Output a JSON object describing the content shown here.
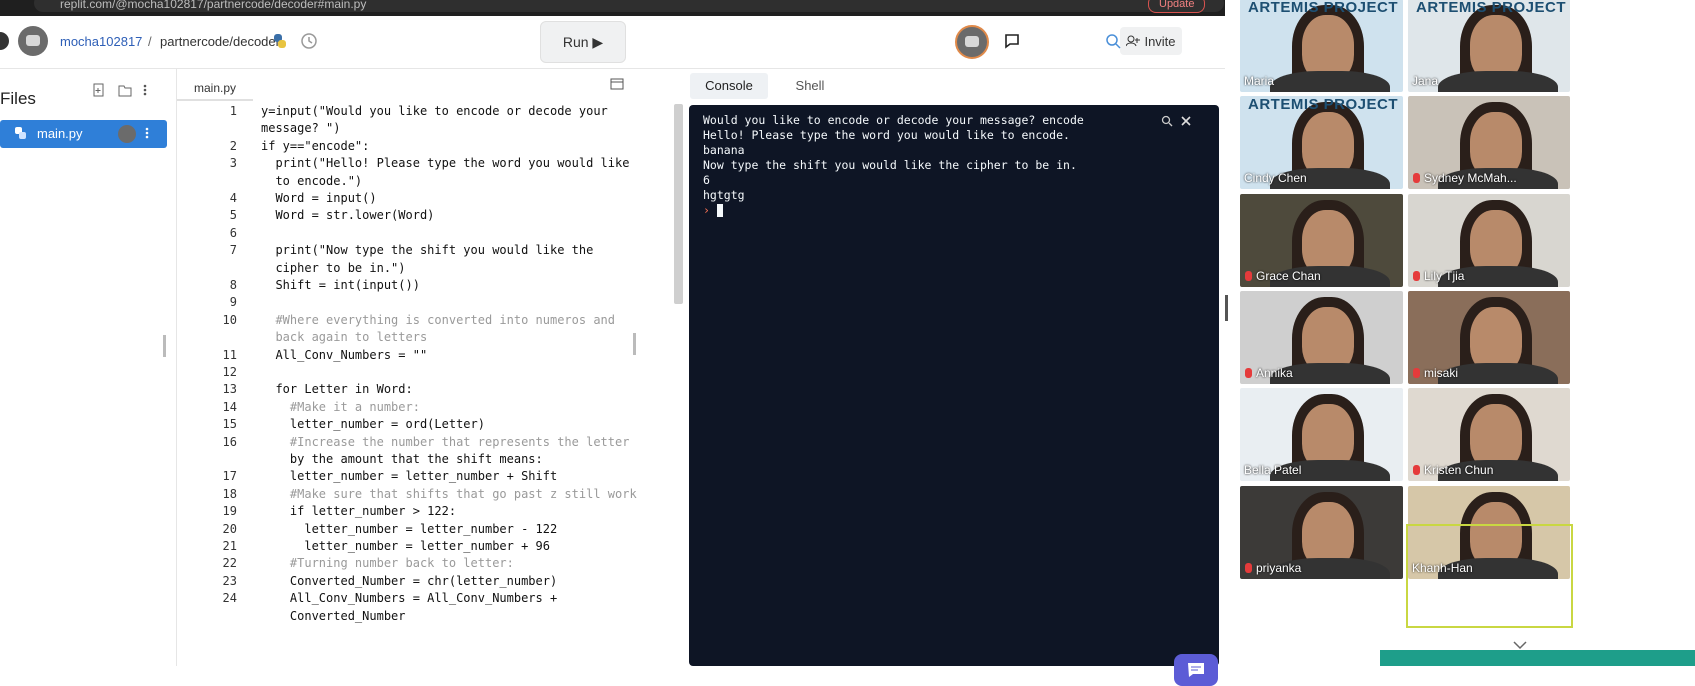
{
  "browser": {
    "url": "replit.com/@mocha102817/partnercode/decoder#main.py",
    "update_label": "Update"
  },
  "header": {
    "username": "mocha102817",
    "separator": "/",
    "project": "partnercode/decoder",
    "run_label": "Run ▶",
    "invite_label": "Invite"
  },
  "sidebar": {
    "title": "Files",
    "files": [
      {
        "name": "main.py"
      }
    ]
  },
  "editor": {
    "tab": "main.py",
    "lines": [
      {
        "n": "1",
        "text": "y=input(\"Would you like to encode or decode your"
      },
      {
        "n": "",
        "text": "message? \")"
      },
      {
        "n": "2",
        "text": "if y==\"encode\":"
      },
      {
        "n": "3",
        "text": "  print(\"Hello! Please type the word you would like"
      },
      {
        "n": "",
        "text": "  to encode.\")"
      },
      {
        "n": "4",
        "text": "  Word = input()"
      },
      {
        "n": "5",
        "text": "  Word = str.lower(Word)"
      },
      {
        "n": "6",
        "text": ""
      },
      {
        "n": "7",
        "text": "  print(\"Now type the shift you would like the"
      },
      {
        "n": "",
        "text": "  cipher to be in.\")"
      },
      {
        "n": "8",
        "text": "  Shift = int(input())"
      },
      {
        "n": "9",
        "text": ""
      },
      {
        "n": "10",
        "text": "  #Where everything is converted into numeros and"
      },
      {
        "n": "",
        "text": "  back again to letters"
      },
      {
        "n": "11",
        "text": "  All_Conv_Numbers = \"\""
      },
      {
        "n": "12",
        "text": ""
      },
      {
        "n": "13",
        "text": "  for Letter in Word:"
      },
      {
        "n": "14",
        "text": "    #Make it a number:"
      },
      {
        "n": "15",
        "text": "    letter_number = ord(Letter)"
      },
      {
        "n": "16",
        "text": "    #Increase the number that represents the letter"
      },
      {
        "n": "",
        "text": "    by the amount that the shift means:"
      },
      {
        "n": "17",
        "text": "    letter_number = letter_number + Shift"
      },
      {
        "n": "18",
        "text": "    #Make sure that shifts that go past z still work"
      },
      {
        "n": "19",
        "text": "    if letter_number > 122:"
      },
      {
        "n": "20",
        "text": "      letter_number = letter_number - 122"
      },
      {
        "n": "21",
        "text": "      letter_number = letter_number + 96"
      },
      {
        "n": "22",
        "text": "    #Turning number back to letter:"
      },
      {
        "n": "23",
        "text": "    Converted_Number = chr(letter_number)"
      },
      {
        "n": "24",
        "text": "    All_Conv_Numbers = All_Conv_Numbers +"
      },
      {
        "n": "",
        "text": "    Converted_Number"
      }
    ]
  },
  "console": {
    "tabs": [
      "Console",
      "Shell"
    ],
    "output": [
      "Would you like to encode or decode your message? encode",
      "Hello! Please type the word you would like to encode.",
      "banana",
      "Now type the shift you would like the cipher to be in.",
      "6",
      "hgtgtg"
    ],
    "prompt": "›"
  },
  "zoom": {
    "participants": [
      {
        "name": "Maria",
        "muted": false,
        "banner": "ARTEMIS PROJECT",
        "bg": "#cfe2ee"
      },
      {
        "name": "Jana",
        "muted": false,
        "banner": "ARTEMIS PROJECT",
        "bg": "#dfe6ea"
      },
      {
        "name": "Cindy Chen",
        "muted": false,
        "banner": "ARTEMIS PROJECT",
        "bg": "#cfe2ee"
      },
      {
        "name": "Sydney McMah...",
        "muted": true,
        "banner": "",
        "bg": "#c9c2b8"
      },
      {
        "name": "Grace Chan",
        "muted": true,
        "banner": "",
        "bg": "#4e4a3c"
      },
      {
        "name": "Lily Tjia",
        "muted": true,
        "banner": "",
        "bg": "#d8d6d0"
      },
      {
        "name": "Annika",
        "muted": true,
        "banner": "",
        "bg": "#cfcfcf"
      },
      {
        "name": "misaki",
        "muted": true,
        "banner": "",
        "bg": "#8a6e5a"
      },
      {
        "name": "Bella Patel",
        "muted": false,
        "banner": "",
        "bg": "#e9eef2"
      },
      {
        "name": "Kristen Chun",
        "muted": true,
        "banner": "",
        "bg": "#dfd9d0"
      },
      {
        "name": "priyanka",
        "muted": true,
        "banner": "",
        "bg": "#3c3a38"
      },
      {
        "name": "Khanh-Han",
        "muted": false,
        "banner": "",
        "bg": "#d6c7a8"
      }
    ]
  }
}
